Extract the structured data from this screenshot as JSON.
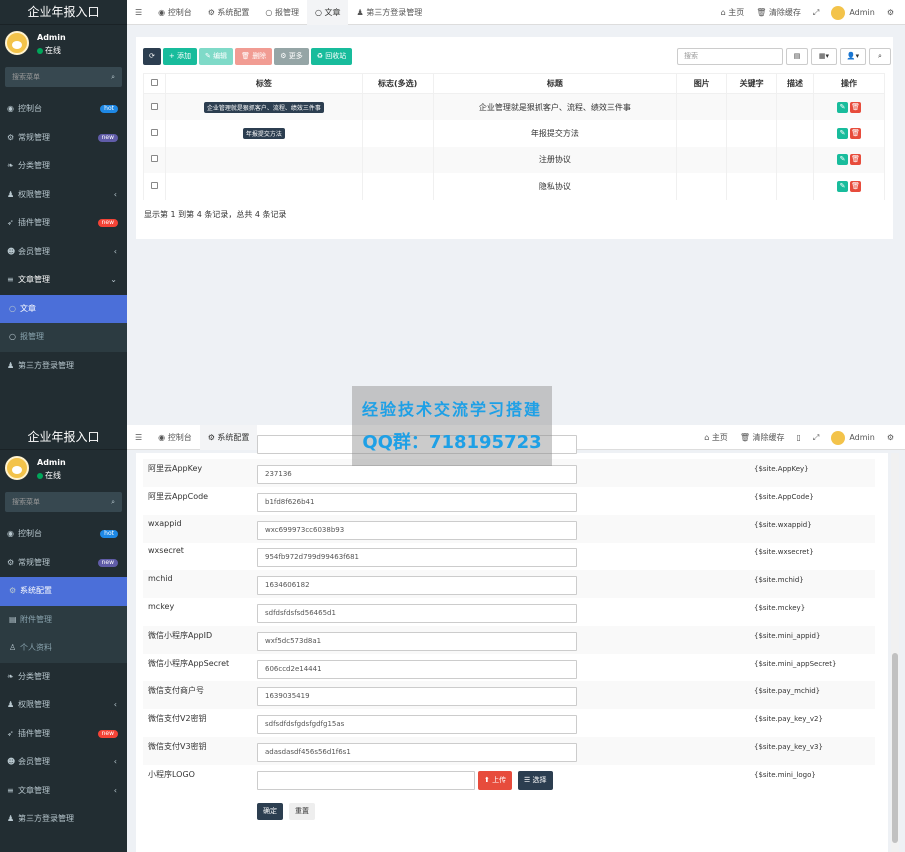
{
  "app": {
    "title": "企业年报入口",
    "user": "Admin",
    "status": "在线",
    "search_placeholder": "搜索菜单"
  },
  "panel1": {
    "menu": [
      {
        "label": "控制台",
        "icon": "dashboard-icon",
        "badge": "hot"
      },
      {
        "label": "常规管理",
        "icon": "cogs-icon",
        "badge": "new"
      },
      {
        "label": "分类管理",
        "icon": "leaf-icon"
      },
      {
        "label": "权限管理",
        "icon": "group-icon",
        "caret": "‹"
      },
      {
        "label": "插件管理",
        "icon": "rocket-icon",
        "badge": "new"
      },
      {
        "label": "会员管理",
        "icon": "user-circle-icon",
        "caret": "‹"
      },
      {
        "label": "文章管理",
        "icon": "list-icon",
        "caret": "⌄"
      },
      {
        "label": "文章",
        "icon": "circle-icon",
        "active": true
      },
      {
        "label": "报管理",
        "icon": "circle-icon"
      },
      {
        "label": "第三方登录管理",
        "icon": "group-icon"
      }
    ],
    "tabs": [
      "控制台",
      "系统配置",
      "报管理",
      "文章",
      "第三方登录管理"
    ],
    "top_right": [
      "主页",
      "清除缓存",
      "",
      "",
      "Admin",
      ""
    ],
    "toolbar": {
      "refresh": "",
      "add": "添加",
      "edit": "编辑",
      "del": "删除",
      "more": "更多",
      "recycle": "回收站"
    },
    "search_placeholder": "搜索",
    "table": {
      "headers": [
        "",
        "标签",
        "标志(多选)",
        "标题",
        "图片",
        "关键字",
        "描述",
        "操作"
      ],
      "rows": [
        {
          "tag": "企业管理就是狠抓客户、流程、绩效三件事",
          "title": "企业管理就是狠抓客户、流程、绩效三件事"
        },
        {
          "tag": "年报提交方法",
          "title": "年报提交方法"
        },
        {
          "tag": "",
          "title": "注册协议"
        },
        {
          "tag": "",
          "title": "隐私协议"
        }
      ]
    },
    "footer": "显示第 1 到第 4 条记录，总共 4 条记录"
  },
  "panel2": {
    "menu": [
      {
        "label": "控制台",
        "icon": "dashboard-icon",
        "badge": "hot"
      },
      {
        "label": "常规管理",
        "icon": "cogs-icon",
        "badge": "new"
      },
      {
        "label": "系统配置",
        "icon": "cog-icon",
        "active": true
      },
      {
        "label": "附件管理",
        "icon": "file-icon"
      },
      {
        "label": "个人资料",
        "icon": "user-icon"
      },
      {
        "label": "分类管理",
        "icon": "leaf-icon"
      },
      {
        "label": "权限管理",
        "icon": "group-icon",
        "caret": "‹"
      },
      {
        "label": "插件管理",
        "icon": "rocket-icon",
        "badge": "new"
      },
      {
        "label": "会员管理",
        "icon": "user-circle-icon",
        "caret": "‹"
      },
      {
        "label": "文章管理",
        "icon": "list-icon",
        "caret": "‹"
      },
      {
        "label": "第三方登录管理",
        "icon": "group-icon"
      }
    ],
    "tabs": [
      "控制台",
      "系统配置"
    ],
    "fields": [
      {
        "label": "阿里云AppKey",
        "value": "237136",
        "var": "{$site.AppKey}"
      },
      {
        "label": "阿里云AppCode",
        "value": "b1fd8f626b41",
        "var": "{$site.AppCode}"
      },
      {
        "label": "wxappid",
        "value": "wxc699973cc6038b93",
        "var": "{$site.wxappid}"
      },
      {
        "label": "wxsecret",
        "value": "954fb972d799d99463f681",
        "var": "{$site.wxsecret}"
      },
      {
        "label": "mchid",
        "value": "1634606182",
        "var": "{$site.mchid}"
      },
      {
        "label": "mckey",
        "value": "sdfdsfdsfsd56465d1",
        "var": "{$site.mckey}"
      },
      {
        "label": "微信小程序AppID",
        "value": "wxf5dc573d8a1",
        "var": "{$site.mini_appid}"
      },
      {
        "label": "微信小程序AppSecret",
        "value": "606ccd2e14441",
        "var": "{$site.mini_appSecret}"
      },
      {
        "label": "微信支付商户号",
        "value": "1639035419",
        "var": "{$site.pay_mchid}"
      },
      {
        "label": "微信支付V2密钥",
        "value": "sdfsdfdsfgdsfgdfg15as",
        "var": "{$site.pay_key_v2}"
      },
      {
        "label": "微信支付V3密钥",
        "value": "adasdasdf456s56d1f6s1",
        "var": "{$site.pay_key_v3}"
      },
      {
        "label": "小程序LOGO",
        "value": "",
        "var": "{$site.mini_logo}"
      }
    ],
    "upload": "上传",
    "choose": "选择",
    "submit": "确定",
    "reset": "重置"
  },
  "watermark": {
    "line1": "经验技术交流学习搭建",
    "line2": "QQ群：718195723"
  }
}
